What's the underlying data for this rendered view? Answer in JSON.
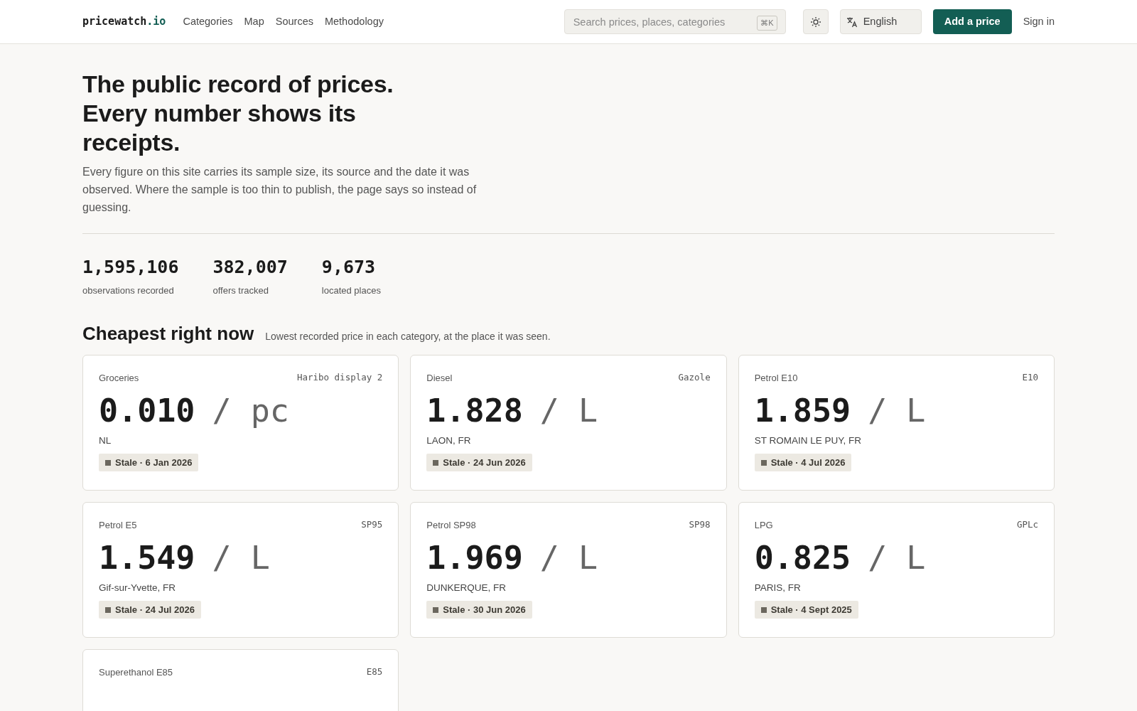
{
  "nav": {
    "logo_main": "pricewatch",
    "logo_suffix": ".io",
    "links": [
      "Categories",
      "Map",
      "Sources",
      "Methodology"
    ],
    "search": {
      "placeholder": "Search prices, places, categories",
      "shortcut": "⌘K"
    },
    "language": "English",
    "add_button": "Add a price",
    "sign_in": "Sign in"
  },
  "hero": {
    "title_lines": [
      "The public record of prices.",
      "Every number shows its",
      "receipts."
    ],
    "lead": "Every figure on this site carries its sample size, its source and the date it was observed. Where the sample is too thin to publish, the page says so instead of guessing."
  },
  "stats": [
    {
      "value": "1,595,106",
      "label": "observations recorded"
    },
    {
      "value": "382,007",
      "label": "offers tracked"
    },
    {
      "value": "9,673",
      "label": "located places"
    }
  ],
  "section": {
    "title": "Cheapest right now",
    "subtitle": "Lowest recorded price in each category, at the place it was seen."
  },
  "cards": [
    {
      "category": "Groceries",
      "product": "Haribo display 2",
      "price": "0.010",
      "unit": "/ pc",
      "place": "NL",
      "badge": "Stale · 6 Jan 2026",
      "kind": "stale"
    },
    {
      "category": "Diesel",
      "product": "Gazole",
      "price": "1.828",
      "unit": "/ L",
      "place": "LAON, FR",
      "badge": "Stale · 24 Jun 2026",
      "kind": "stale"
    },
    {
      "category": "Petrol E10",
      "product": "E10",
      "price": "1.859",
      "unit": "/ L",
      "place": "ST ROMAIN LE PUY, FR",
      "badge": "Stale · 4 Jul 2026",
      "kind": "stale"
    },
    {
      "category": "Petrol E5",
      "product": "SP95",
      "price": "1.549",
      "unit": "/ L",
      "place": "Gif-sur-Yvette, FR",
      "badge": "Stale · 24 Jul 2026",
      "kind": "stale"
    },
    {
      "category": "Petrol SP98",
      "product": "SP98",
      "price": "1.969",
      "unit": "/ L",
      "place": "DUNKERQUE, FR",
      "badge": "Stale · 30 Jun 2026",
      "kind": "stale"
    },
    {
      "category": "LPG",
      "product": "GPLc",
      "price": "0.825",
      "unit": "/ L",
      "place": "PARIS, FR",
      "badge": "Stale · 4 Sept 2025",
      "kind": "stale"
    },
    {
      "category": "Superethanol E85",
      "product": "E85"
    }
  ]
}
